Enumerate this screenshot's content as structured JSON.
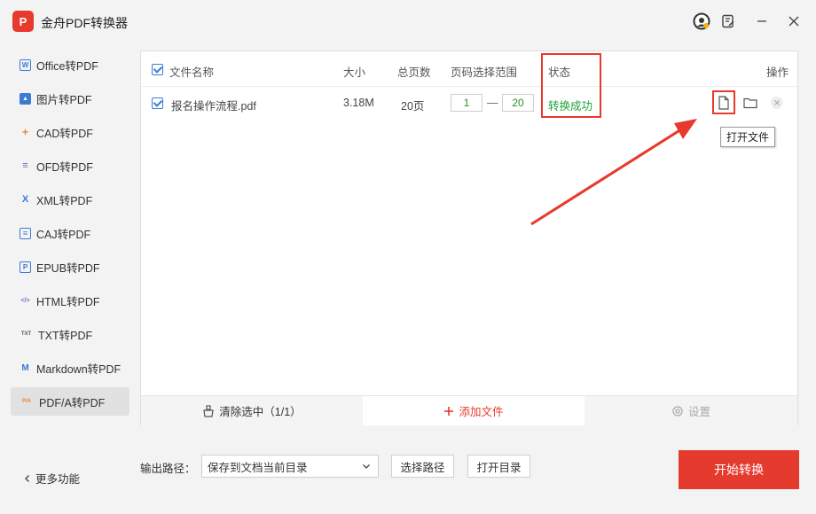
{
  "app": {
    "title": "金舟PDF转换器",
    "logo_text": "P"
  },
  "sidebar": {
    "items": [
      {
        "label": "Office转PDF",
        "icon": "W",
        "color": "#3a7bd5"
      },
      {
        "label": "图片转PDF",
        "icon": "▲",
        "color": "#3a7bd5"
      },
      {
        "label": "CAD转PDF",
        "icon": "+",
        "color": "#f08030"
      },
      {
        "label": "OFD转PDF",
        "icon": "≡",
        "color": "#8a5ad0"
      },
      {
        "label": "XML转PDF",
        "icon": "X",
        "color": "#3a7bd5"
      },
      {
        "label": "CAJ转PDF",
        "icon": "≡",
        "color": "#3a7bd5"
      },
      {
        "label": "EPUB转PDF",
        "icon": "P",
        "color": "#3a7bd5"
      },
      {
        "label": "HTML转PDF",
        "icon": "</>",
        "color": "#8a5ad0"
      },
      {
        "label": "TXT转PDF",
        "icon": "TXT",
        "color": "#555555"
      },
      {
        "label": "Markdown转PDF",
        "icon": "M",
        "color": "#3a7bd5"
      },
      {
        "label": "PDF/A转PDF",
        "icon": "P/A",
        "color": "#f08030"
      }
    ],
    "more": "更多功能"
  },
  "table": {
    "headers": {
      "name": "文件名称",
      "size": "大小",
      "pages": "总页数",
      "range": "页码选择范围",
      "status": "状态",
      "actions": "操作"
    },
    "rows": [
      {
        "name": "报名操作流程.pdf",
        "size": "3.18M",
        "pages": "20页",
        "from": "1",
        "dash": "—",
        "to": "20",
        "status": "转换成功"
      }
    ],
    "tooltip": "打开文件"
  },
  "bottom": {
    "clear": "清除选中（1/1）",
    "add": "添加文件",
    "settings": "设置"
  },
  "footer": {
    "output_label": "输出路径：",
    "output_value": "保存到文档当前目录",
    "choose_path": "选择路径",
    "open_dir": "打开目录",
    "start": "开始转换"
  }
}
